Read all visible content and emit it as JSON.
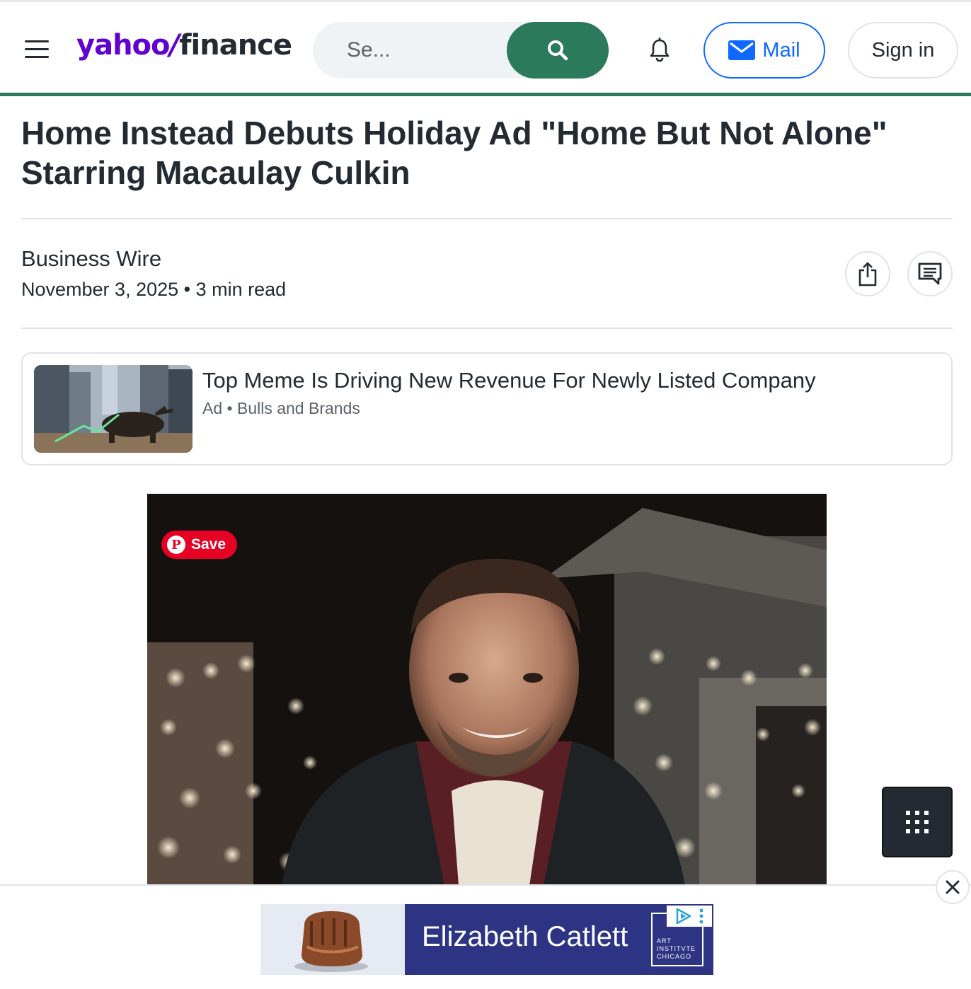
{
  "header": {
    "logo_yahoo": "yahoo",
    "logo_slash": "/",
    "logo_finance": "finance",
    "search_placeholder": "Se...",
    "mail_label": "Mail",
    "signin_label": "Sign in",
    "accent_color": "#2b7a5c",
    "brand_color": "#6001d2"
  },
  "article": {
    "title": "Home Instead Debuts Holiday Ad \"Home But Not Alone\" Starring Macaulay Culkin",
    "source": "Business Wire",
    "date": "November 3, 2025",
    "separator": "•",
    "read_time": "3 min read"
  },
  "ad_card": {
    "title": "Top Meme Is Driving New Revenue For Newly Listed Company",
    "ad_label": "Ad",
    "separator": "•",
    "advertiser": "Bulls and Brands"
  },
  "hero": {
    "save_label": "Save"
  },
  "banner": {
    "text": "Elizabeth Catlett",
    "logo_text": "ART\nINSTITVTE\nCHICAGO"
  },
  "icons": {
    "menu": "hamburger-icon",
    "search": "search-icon",
    "bell": "bell-icon",
    "mail": "envelope-icon",
    "share": "share-icon",
    "comment": "comment-icon",
    "grid": "grid-icon",
    "close": "close-icon"
  }
}
